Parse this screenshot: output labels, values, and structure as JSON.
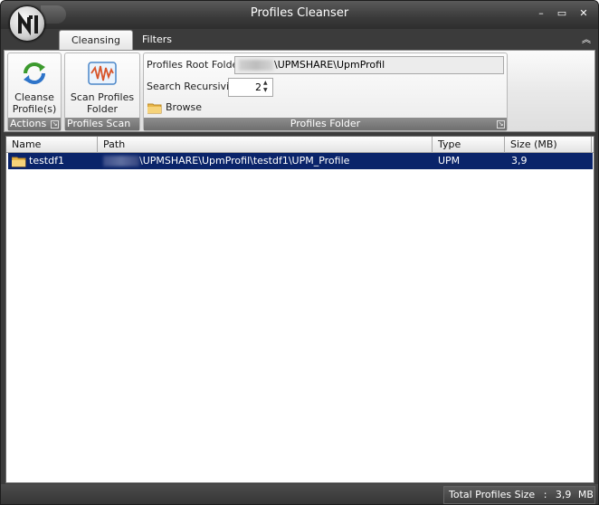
{
  "window": {
    "title": "Profiles Cleanser"
  },
  "title_buttons": {
    "minimize": "–",
    "maximize": "▭",
    "close": "✕"
  },
  "tabs": [
    {
      "label": "Cleansing",
      "active": true
    },
    {
      "label": "Filters",
      "active": false
    }
  ],
  "ribbon": {
    "actions": {
      "button_label_1": "Cleanse",
      "button_label_2": "Profile(s)",
      "group_label": "Actions"
    },
    "scan": {
      "button_label_1": "Scan Profiles",
      "button_label_2": "Folder",
      "group_label": "Profiles Scan"
    },
    "folder": {
      "root_label": "Profiles Root Folder",
      "root_value": "\\UPMSHARE\\UpmProfil",
      "recursivity_label": "Search Recursivity",
      "recursivity_value": "2",
      "browse_label": "Browse",
      "group_label": "Profiles Folder"
    }
  },
  "table": {
    "columns": [
      "Name",
      "Path",
      "Type",
      "Size (MB)"
    ],
    "rows": [
      {
        "name": "testdf1",
        "path": "\\UPMSHARE\\UpmProfil\\testdf1\\UPM_Profile",
        "type": "UPM",
        "size": "3,9",
        "selected": true
      }
    ]
  },
  "status": {
    "label": "Total Profiles Size",
    "separator": ":",
    "value": "3,9",
    "unit": "MB"
  },
  "colors": {
    "selection": "#0a246a",
    "frame": "#3b3b3b"
  }
}
